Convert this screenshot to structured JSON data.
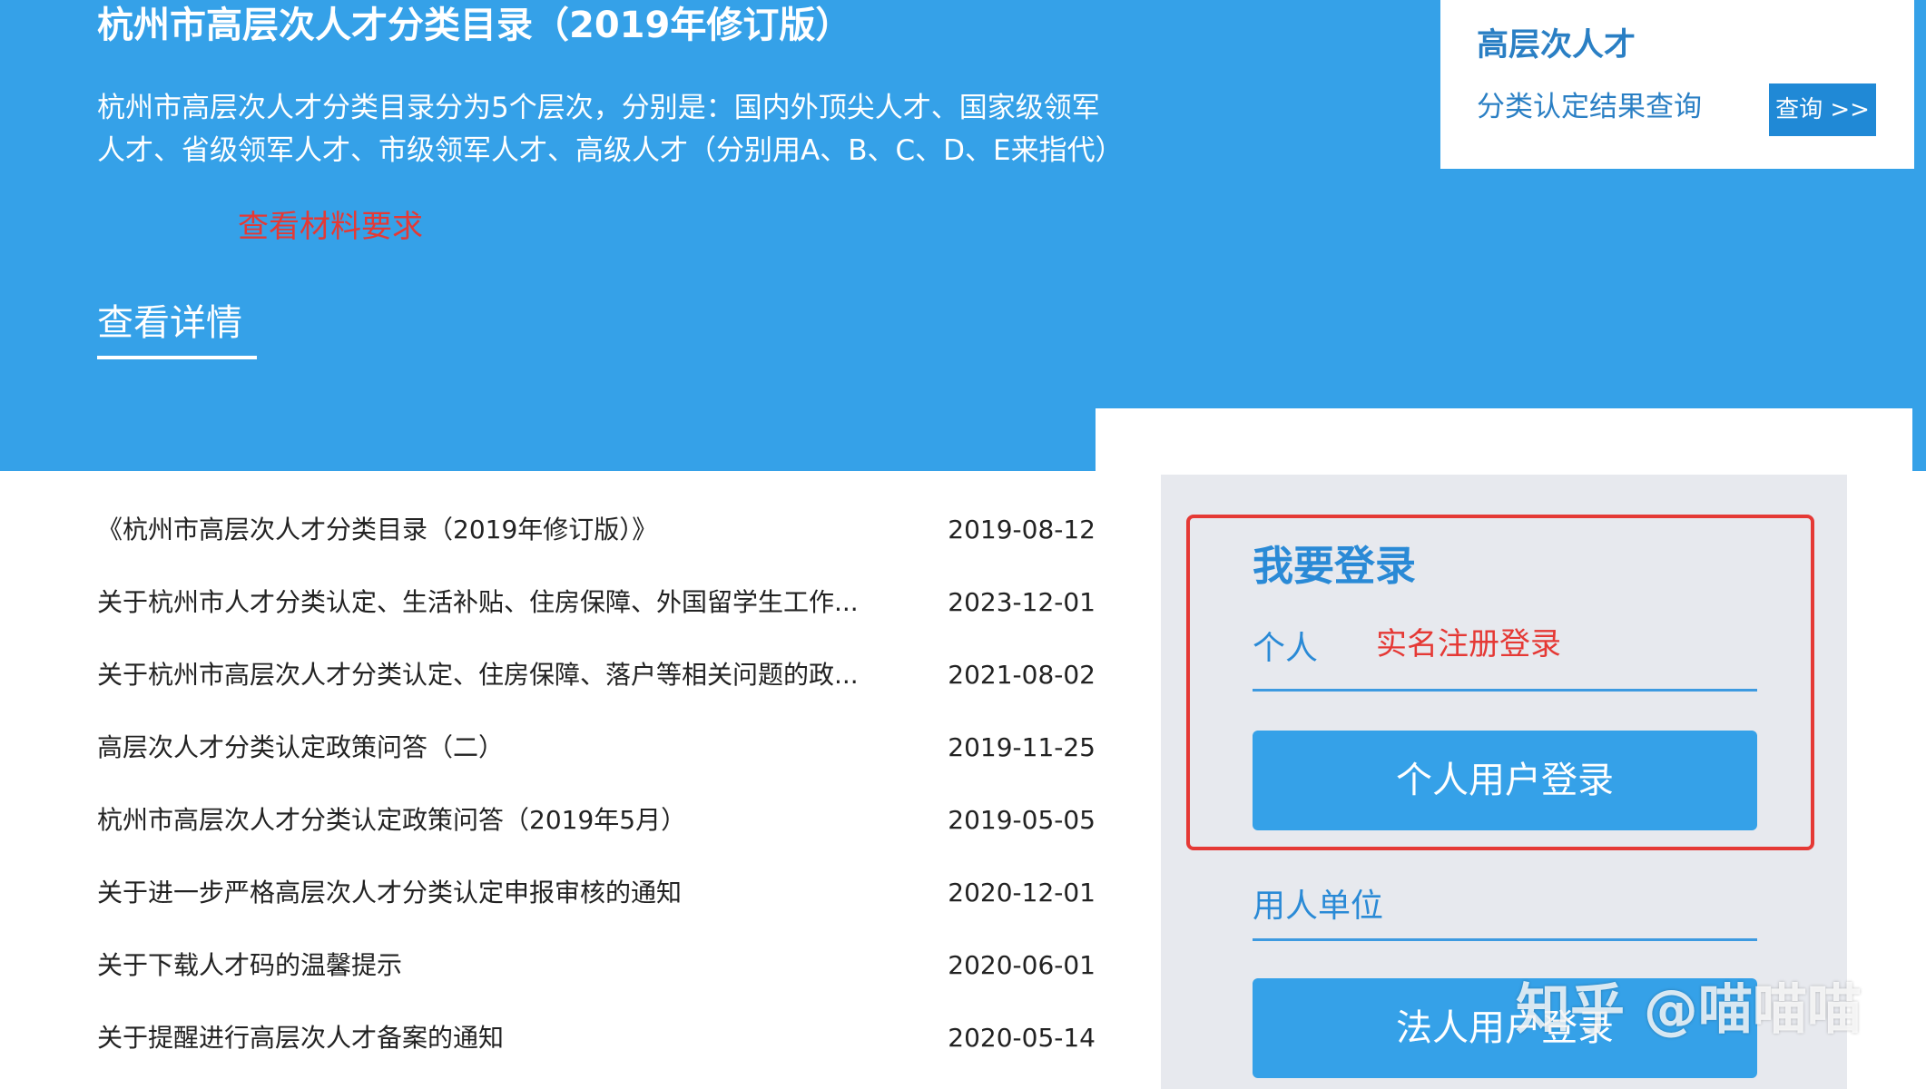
{
  "banner": {
    "title": "杭州市高层次人才分类目录（2019年修订版）",
    "description": "杭州市高层次人才分类目录分为5个层次，分别是：国内外顶尖人才、国家级领军人才、省级领军人才、市级领军人才、高级人才（分别用A、B、C、D、E来指代）",
    "note": "查看材料要求",
    "detail_link": "查看详情"
  },
  "query_box": {
    "title": "高层次人才",
    "subtitle": "分类认定结果查询",
    "button": "查询 >>"
  },
  "news": [
    {
      "title": "《杭州市高层次人才分类目录（2019年修订版）》",
      "date": "2019-08-12"
    },
    {
      "title": "关于杭州市人才分类认定、生活补贴、住房保障、外国留学生工作...",
      "date": "2023-12-01"
    },
    {
      "title": "关于杭州市高层次人才分类认定、住房保障、落户等相关问题的政...",
      "date": "2021-08-02"
    },
    {
      "title": "高层次人才分类认定政策问答（二）",
      "date": "2019-11-25"
    },
    {
      "title": "杭州市高层次人才分类认定政策问答（2019年5月）",
      "date": "2019-05-05"
    },
    {
      "title": "关于进一步严格高层次人才分类认定申报审核的通知",
      "date": "2020-12-01"
    },
    {
      "title": "关于下载人才码的温馨提示",
      "date": "2020-06-01"
    },
    {
      "title": "关于提醒进行高层次人才备案的通知",
      "date": "2020-05-14"
    }
  ],
  "login": {
    "title": "我要登录",
    "personal_label": "个人",
    "personal_note": "实名注册登录",
    "personal_button": "个人用户登录",
    "company_label": "用人单位",
    "company_button": "法人用户登录"
  },
  "watermark": "知乎 @喵喵喵",
  "colors": {
    "banner_blue": "#35a1e8",
    "link_blue": "#2a8ad6",
    "annotation_red": "#e53935",
    "panel_gray": "#e7e9ee"
  }
}
